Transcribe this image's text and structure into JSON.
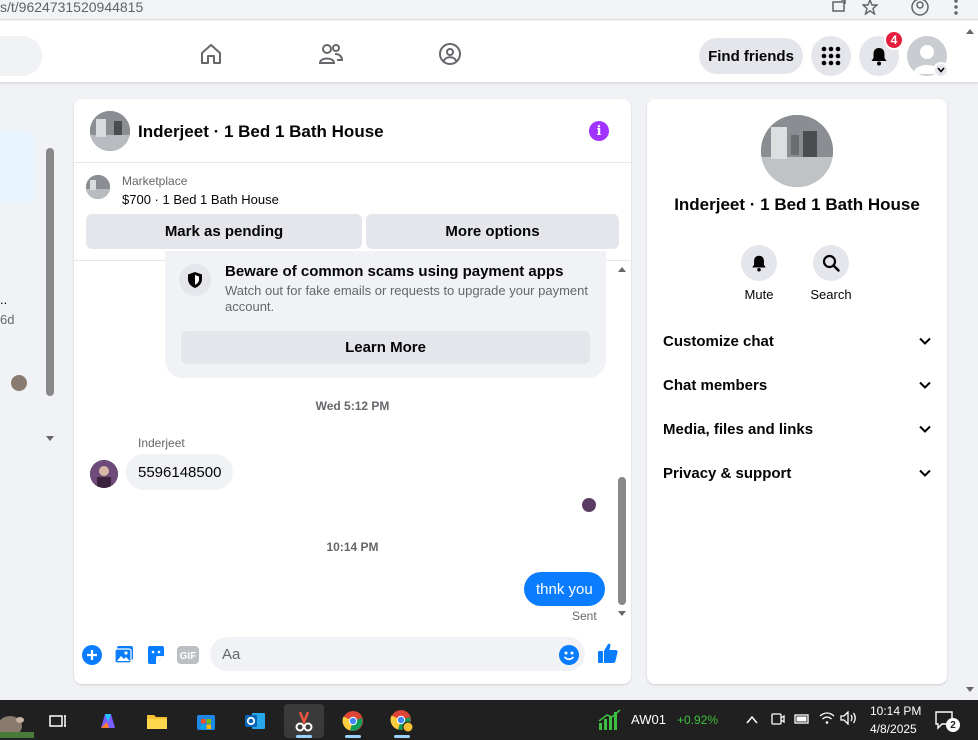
{
  "browser": {
    "url_fragment": "s/t/9624731520944815"
  },
  "topnav": {
    "find_friends": "Find friends",
    "notification_count": "4"
  },
  "left_list": {
    "dots": "..",
    "count": "6d"
  },
  "chat": {
    "title": "Inderjeet · 1 Bed 1 Bath House",
    "marketplace": {
      "label": "Marketplace",
      "price_title": "$700 · 1 Bed 1 Bath House",
      "mark_pending": "Mark as pending",
      "more_options": "More options"
    },
    "scam_notice": {
      "title": "Beware of common scams using payment apps",
      "text": "Watch out for fake emails or requests to upgrade your payment account.",
      "learn_more": "Learn More"
    },
    "timestamp1": "Wed 5:12 PM",
    "sender_name": "Inderjeet",
    "received_message": "5596148500",
    "timestamp2": "10:14 PM",
    "sent_message": "thnk you",
    "sent_status": "Sent",
    "composer_placeholder": "Aa"
  },
  "right_panel": {
    "name": "Inderjeet · 1 Bed 1 Bath House",
    "mute": "Mute",
    "search": "Search",
    "rows": [
      "Customize chat",
      "Chat members",
      "Media, files and links",
      "Privacy & support"
    ]
  },
  "taskbar": {
    "stock_name": "AW01",
    "stock_change": "+0.92%",
    "time": "10:14 PM",
    "date": "4/8/2025",
    "notif_count": "2"
  },
  "colors": {
    "accent_blue": "#0a7cff",
    "info_purple": "#a033ff",
    "badge_red": "#e41e3f",
    "stock_green": "#3fbf3f"
  }
}
